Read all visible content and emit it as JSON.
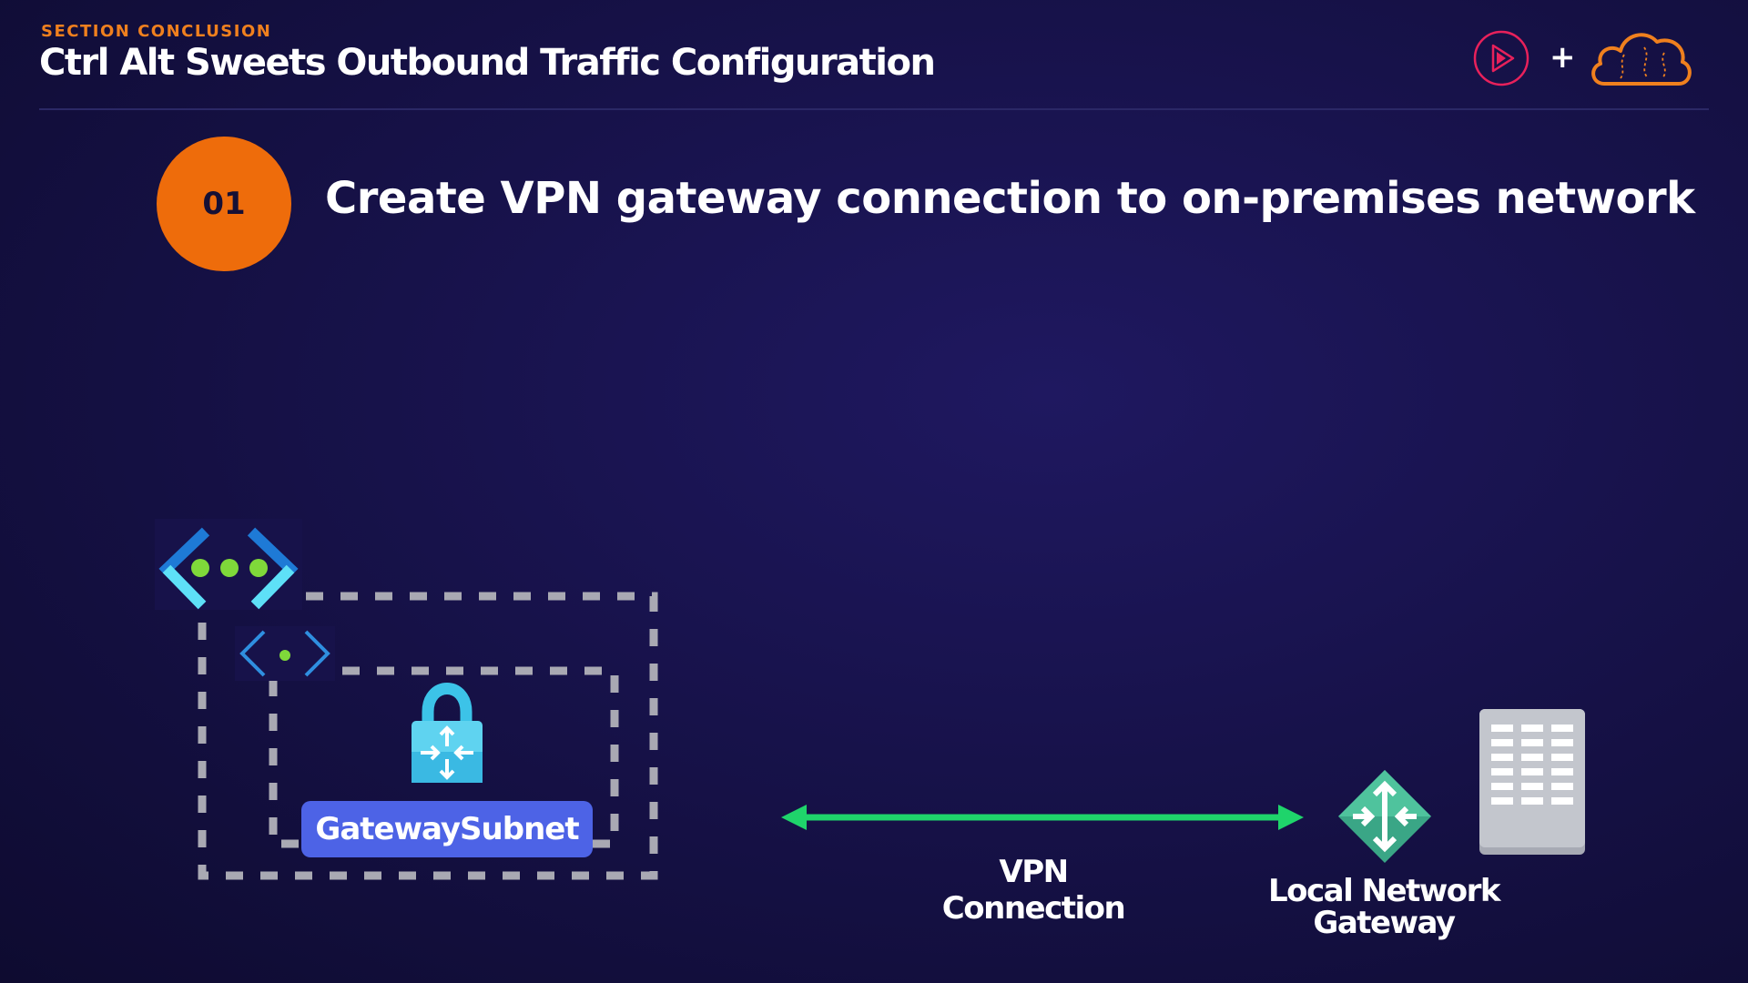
{
  "header": {
    "eyebrow": "SECTION CONCLUSION",
    "title": "Ctrl Alt Sweets Outbound Traffic Configuration",
    "plus": "+"
  },
  "logos": [
    {
      "icon": "play-logo-icon",
      "color": "#e8215b"
    },
    {
      "icon": "cloud-logo-icon",
      "color": "#f0801e"
    }
  ],
  "step": {
    "number": "01",
    "text": "Create VPN gateway connection to on-premises network"
  },
  "diagram": {
    "nodes": [
      {
        "id": "vnet",
        "icon": "virtual-network-icon"
      },
      {
        "id": "subnet",
        "icon": "subnet-icon"
      },
      {
        "id": "vpn-gateway",
        "icon": "vpn-gateway-lock-icon"
      },
      {
        "id": "local-network-gateway",
        "icon": "local-network-gateway-icon"
      },
      {
        "id": "on-premises",
        "icon": "building-icon"
      }
    ],
    "subnet_label": "GatewaySubnet",
    "connection_label": "VPN Connection",
    "lng_label_line1": "Local Network",
    "lng_label_line2": "Gateway"
  },
  "colors": {
    "background": "#17124a",
    "accent_orange": "#ee6c0b",
    "subnet_pill": "#4d63e6",
    "connection_arrow": "#1fd46b",
    "dashed_border": "#a9a9b3"
  }
}
